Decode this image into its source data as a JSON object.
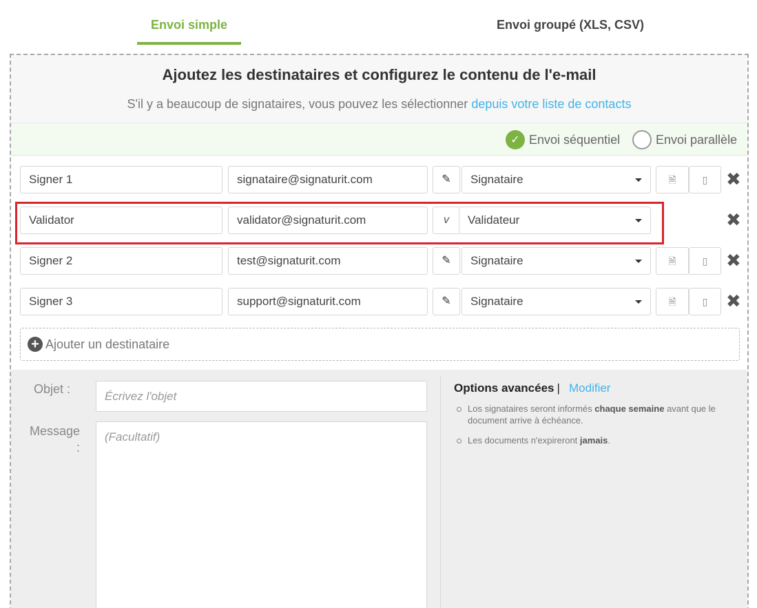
{
  "tabs": {
    "simple": "Envoi simple",
    "grouped": "Envoi groupé (XLS, CSV)"
  },
  "header": {
    "title": "Ajoutez les destinataires et configurez le contenu de l'e-mail",
    "subtitle_prefix": "S'il y a beaucoup de signataires, vous pouvez les sélectionner",
    "subtitle_link": "depuis votre liste de contacts"
  },
  "mode": {
    "sequential": "Envoi séquentiel",
    "parallel": "Envoi parallèle",
    "selected": "sequential"
  },
  "recipients": [
    {
      "name": "Signer 1",
      "email": "signataire@signaturit.com",
      "type_icon": "pencil-icon",
      "role": "Signataire"
    },
    {
      "name": "Validator",
      "email": "validator@signaturit.com",
      "type_icon": "v",
      "role": "Validateur"
    },
    {
      "name": "Signer 2",
      "email": "test@signaturit.com",
      "type_icon": "pencil-icon",
      "role": "Signataire"
    },
    {
      "name": "Signer 3",
      "email": "support@signaturit.com",
      "type_icon": "pencil-icon",
      "role": "Signataire"
    }
  ],
  "add_recipient": "Ajouter un destinataire",
  "form": {
    "subject_label": "Objet :",
    "subject_placeholder": "Écrivez l'objet",
    "message_label_line1": "Message",
    "message_label_line2": ":",
    "message_placeholder": "(Facultatif)"
  },
  "options": {
    "title": "Options avancées",
    "separator": "|",
    "modify": "Modifier",
    "items": [
      {
        "pre": "Los signataires seront informés",
        "bold": "chaque semaine",
        "post": "avant que le document arrive à échéance."
      },
      {
        "pre": "Les documents n'expireront",
        "bold": "jamais",
        "post": "."
      }
    ]
  },
  "colors": {
    "accent_green": "#7cb342",
    "link_blue": "#42b3e8",
    "highlight_red": "#d9232d"
  }
}
